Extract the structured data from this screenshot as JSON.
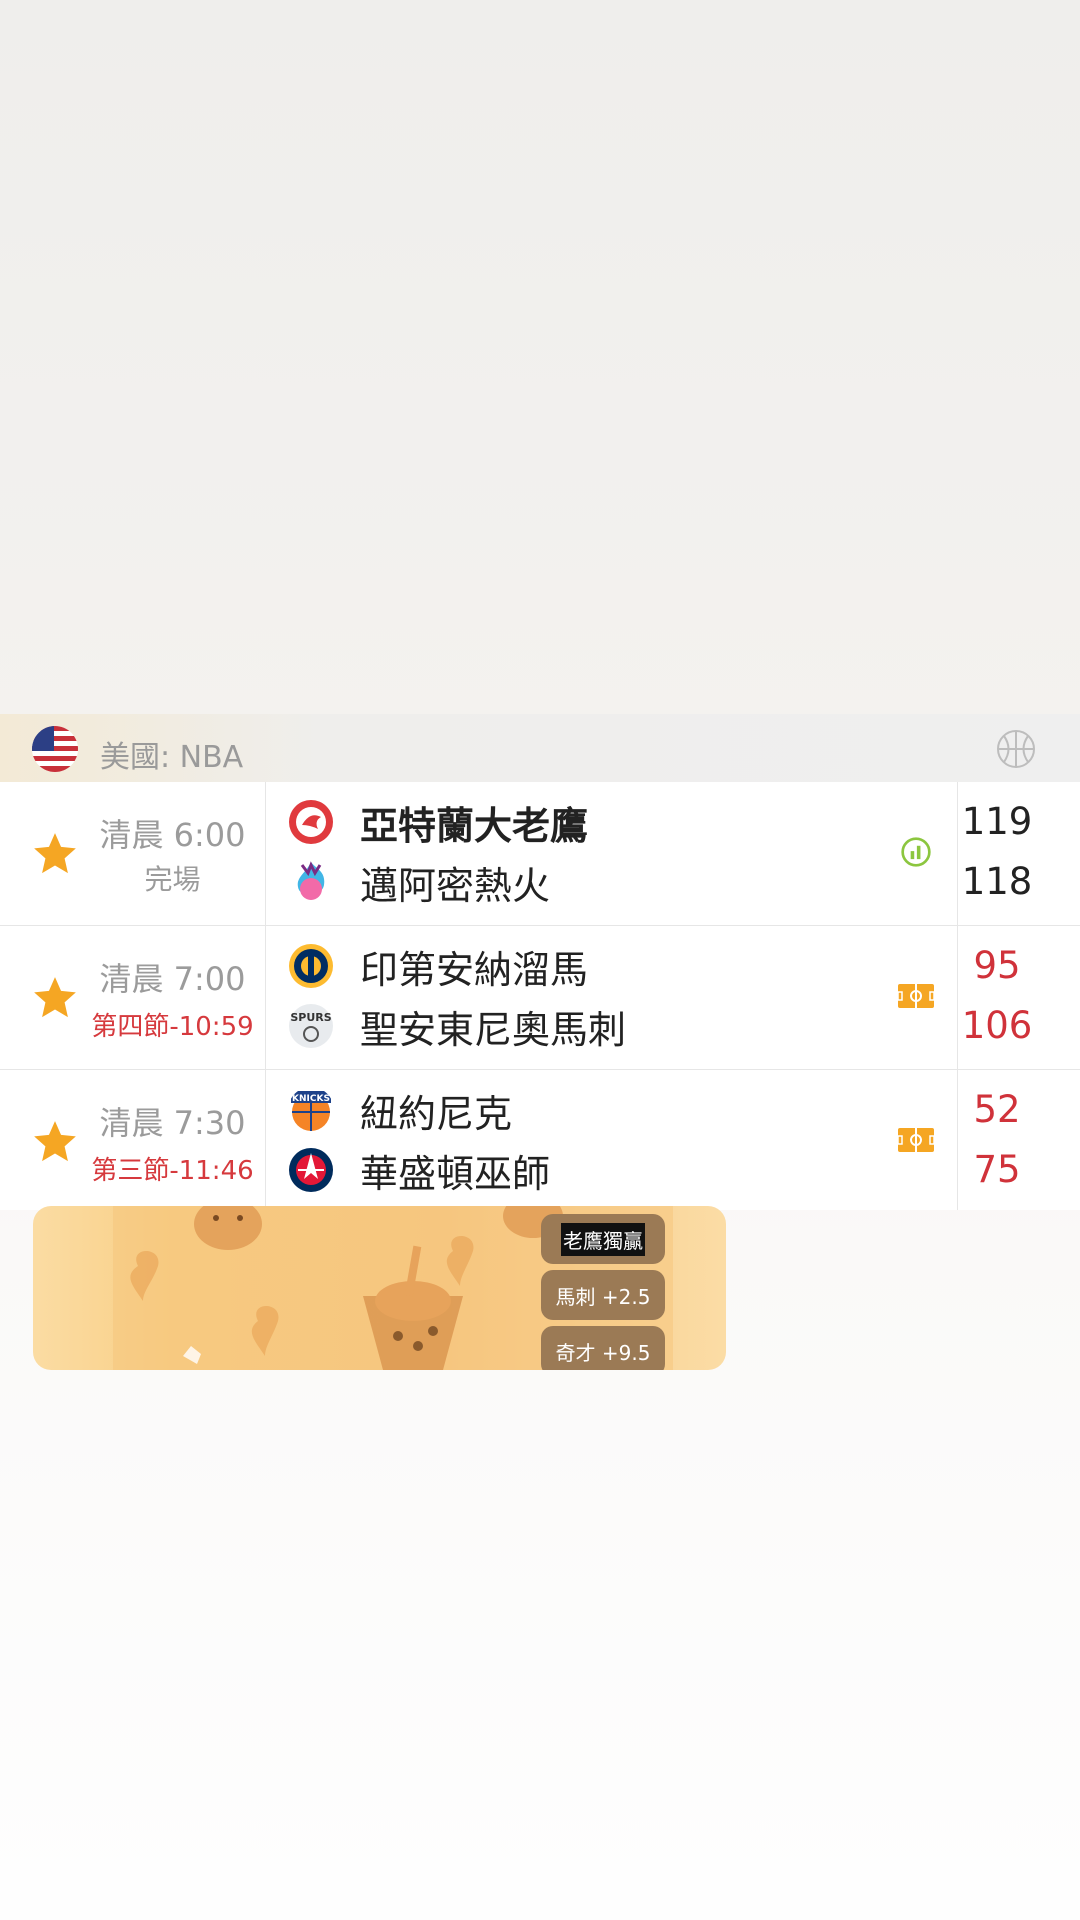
{
  "league": {
    "country_flag": "us-flag-icon",
    "name": "美國: NBA",
    "sport_icon": "basketball-icon"
  },
  "games": [
    {
      "time": "清晨 6:00",
      "status": "完場",
      "status_live": false,
      "home": {
        "name": "亞特蘭大老鷹",
        "logo": "hawks-logo",
        "score": "119",
        "bold": true
      },
      "away": {
        "name": "邁阿密熱火",
        "logo": "heat-logo",
        "score": "118"
      },
      "icon": "stats-icon"
    },
    {
      "time": "清晨 7:00",
      "status": "第四節-10:59",
      "status_live": true,
      "home": {
        "name": "印第安納溜馬",
        "logo": "pacers-logo",
        "score": "95"
      },
      "away": {
        "name": "聖安東尼奧馬刺",
        "logo": "spurs-logo",
        "score": "106"
      },
      "icon": "court-icon"
    },
    {
      "time": "清晨 7:30",
      "status": "第三節-11:46",
      "status_live": true,
      "home": {
        "name": "紐約尼克",
        "logo": "knicks-logo",
        "score": "52"
      },
      "away": {
        "name": "華盛頓巫師",
        "logo": "wizards-logo",
        "score": "75"
      },
      "icon": "court-icon"
    }
  ],
  "ad": {
    "bets": [
      "老鷹獨贏",
      "馬刺 +2.5",
      "奇才 +9.5"
    ]
  },
  "colors": {
    "accent_star": "#f5a623",
    "live_red": "#d0323a",
    "muted": "#9b9b9b"
  }
}
